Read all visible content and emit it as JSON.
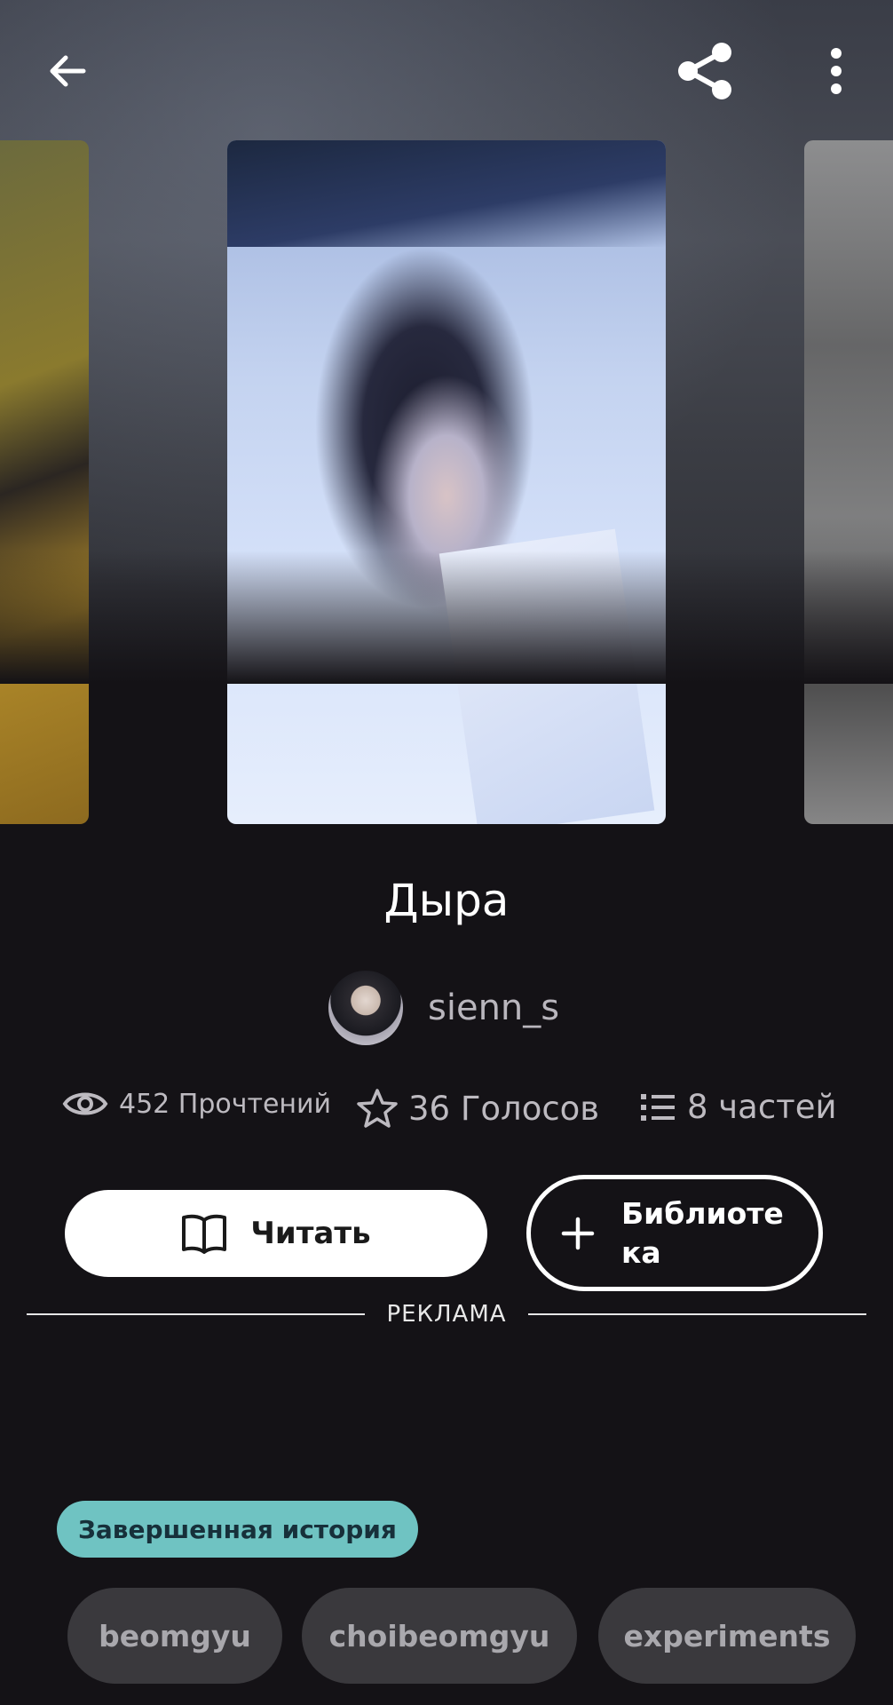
{
  "story": {
    "title": "Дыра",
    "author": "sienn_s",
    "stats": {
      "reads": "452 Прочтений",
      "votes": "36 Голосов",
      "parts": "8 частей"
    }
  },
  "actions": {
    "read_label": "Читать",
    "library_label": "Библиотека"
  },
  "ad": {
    "label": "РЕКЛАМА"
  },
  "status_badge": "Завершенная история",
  "tags": [
    "beomgyu",
    "choibeomgyu",
    "experiments"
  ],
  "icons": {
    "back": "arrow-left-icon",
    "share": "share-icon",
    "more": "more-vertical-icon",
    "reads": "eye-icon",
    "votes": "star-icon",
    "parts": "list-icon",
    "read": "book-open-icon",
    "add": "plus-icon"
  },
  "colors": {
    "background": "#141216",
    "badge": "#6fc3c2",
    "tag": "#3a393d"
  }
}
